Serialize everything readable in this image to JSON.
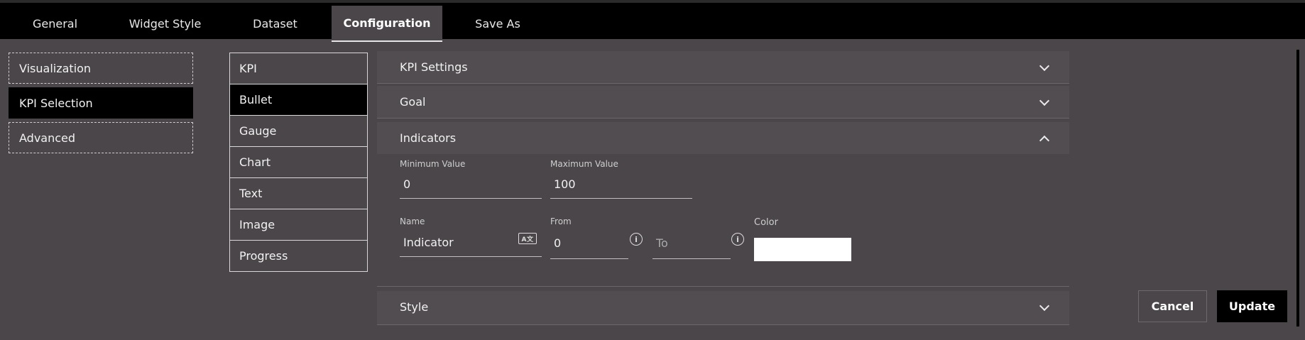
{
  "tabs": [
    "General",
    "Widget Style",
    "Dataset",
    "Configuration",
    "Save As"
  ],
  "left_nav": [
    "Visualization",
    "KPI Selection",
    "Advanced"
  ],
  "kpi_types": [
    "KPI",
    "Bullet",
    "Gauge",
    "Chart",
    "Text",
    "Image",
    "Progress"
  ],
  "panels": {
    "kpi_settings": "KPI Settings",
    "goal": "Goal",
    "indicators": "Indicators",
    "style": "Style"
  },
  "indicators": {
    "min_label": "Minimum Value",
    "min_value": "0",
    "max_label": "Maximum Value",
    "max_value": "100",
    "name_label": "Name",
    "name_value": "Indicator",
    "from_label": "From",
    "from_value": "0",
    "to_placeholder": "To",
    "color_label": "Color",
    "color_value": "#ffffff"
  },
  "buttons": {
    "cancel": "Cancel",
    "update": "Update"
  },
  "icons": {
    "info": "i",
    "translate": "A文"
  }
}
